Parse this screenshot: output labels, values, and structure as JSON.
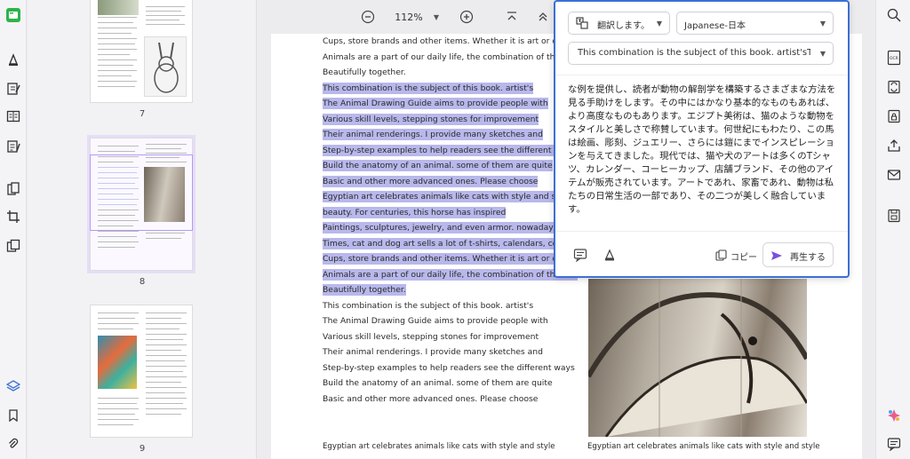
{
  "zoom": {
    "level": "112%"
  },
  "thumbnails": [
    {
      "page": "7"
    },
    {
      "page": "8"
    },
    {
      "page": "9"
    }
  ],
  "document": {
    "lines": [
      {
        "text": "Cups, store brands and other items. Whether it is art or domestic",
        "highlight": false
      },
      {
        "text": "Animals are a part of our daily life, the combination of the two",
        "highlight": false
      },
      {
        "text": "Beautifully together.",
        "highlight": false
      },
      {
        "text": "This combination is the subject of this book. artist's",
        "highlight": true
      },
      {
        "text": "The Animal Drawing Guide aims to provide people with",
        "highlight": true
      },
      {
        "text": "Various skill levels, stepping stones for improvement",
        "highlight": true
      },
      {
        "text": "Their animal renderings. I provide many sketches and",
        "highlight": true
      },
      {
        "text": "Step-by-step examples to help readers see the different ways",
        "highlight": true
      },
      {
        "text": "Build the anatomy of an animal. some of them are quite",
        "highlight": true
      },
      {
        "text": "Basic and other more advanced ones. Please choose",
        "highlight": true
      },
      {
        "text": "Egyptian art celebrates animals like cats with style and style",
        "highlight": true
      },
      {
        "text": "beauty. For centuries, this horse has inspired",
        "highlight": true
      },
      {
        "text": "Paintings, sculptures, jewelry, and even armor. nowadays",
        "highlight": true
      },
      {
        "text": "Times, cat and dog art sells a lot of t-shirts, calendars, coffee",
        "highlight": true
      },
      {
        "text": "Cups, store brands and other items. Whether it is art or domestic",
        "highlight": true
      },
      {
        "text": "Animals are a part of our daily life, the combination of the two",
        "highlight": true
      },
      {
        "text": "Beautifully together.",
        "highlight": true
      },
      {
        "text": "This combination is the subject of this book. artist's",
        "highlight": false
      },
      {
        "text": "The Animal Drawing Guide aims to provide people with",
        "highlight": false
      },
      {
        "text": "Various skill levels, stepping stones for improvement",
        "highlight": false
      },
      {
        "text": "Their animal renderings. I provide many sketches and",
        "highlight": false
      },
      {
        "text": "Step-by-step examples to help readers see the different ways",
        "highlight": false
      },
      {
        "text": "Build the anatomy of an animal. some of them are quite",
        "highlight": false
      },
      {
        "text": "Basic and other more advanced ones. Please choose",
        "highlight": false
      }
    ],
    "bottom_left": "Egyptian art celebrates animals like cats with style and style",
    "bottom_right": "Egyptian art celebrates animals like cats with style and style"
  },
  "translate": {
    "mode": "翻訳します。",
    "language": "Japanese-日本",
    "source_text": "This combination is the subject of this book. artist'sT...",
    "result": "な例を提供し、読者が動物の解剖学を構築するさまざまな方法を見る手助けをします。その中にはかなり基本的なものもあれば、より高度なものもあります。エジプト美術は、猫のような動物をスタイルと美しさで称賛しています。何世紀にもわたり、この馬は絵画、彫刻、ジュエリー、さらには鎧にまでインスピレーションを与えてきました。現代では、猫や犬のアートは多くのTシャツ、カレンダー、コーヒーカップ、店舗ブランド、その他のアイテムが販売されています。アートであれ、家畜であれ、動物は私たちの日常生活の一部であり、その二つが美しく融合しています。",
    "copy_label": "コピー",
    "play_label": "再生する"
  },
  "colors": {
    "accent": "#3b6fd6",
    "highlight": "#b8b8ec",
    "play_icon": "#7b4fe0",
    "brand_green": "#2db34a"
  }
}
